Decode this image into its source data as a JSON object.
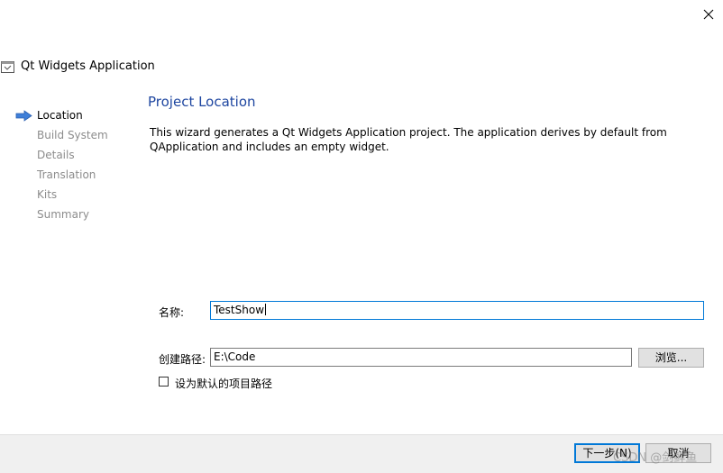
{
  "window": {
    "title": "Qt Widgets Application",
    "close_icon": "close-icon",
    "app_icon": "qt-creator-icon"
  },
  "steps": [
    {
      "label": "Location",
      "active": true
    },
    {
      "label": "Build System",
      "active": false
    },
    {
      "label": "Details",
      "active": false
    },
    {
      "label": "Translation",
      "active": false
    },
    {
      "label": "Kits",
      "active": false
    },
    {
      "label": "Summary",
      "active": false
    }
  ],
  "page": {
    "title": "Project Location",
    "description": "This wizard generates a Qt Widgets Application project. The application derives by default from QApplication and includes an empty widget."
  },
  "form": {
    "name_label": "名称:",
    "name_value": "TestShow",
    "path_label": "创建路径:",
    "path_value": "E:\\Code",
    "browse_label": "浏览...",
    "default_path_label": "设为默认的项目路径",
    "default_path_checked": false
  },
  "footer": {
    "next_label": "下一步(N)",
    "cancel_label": "取消"
  },
  "watermark": "CSDN @剑鲜鱼",
  "colors": {
    "title_blue": "#1e46a0",
    "accent": "#0078d7",
    "step_inactive": "#8c8c8c"
  }
}
